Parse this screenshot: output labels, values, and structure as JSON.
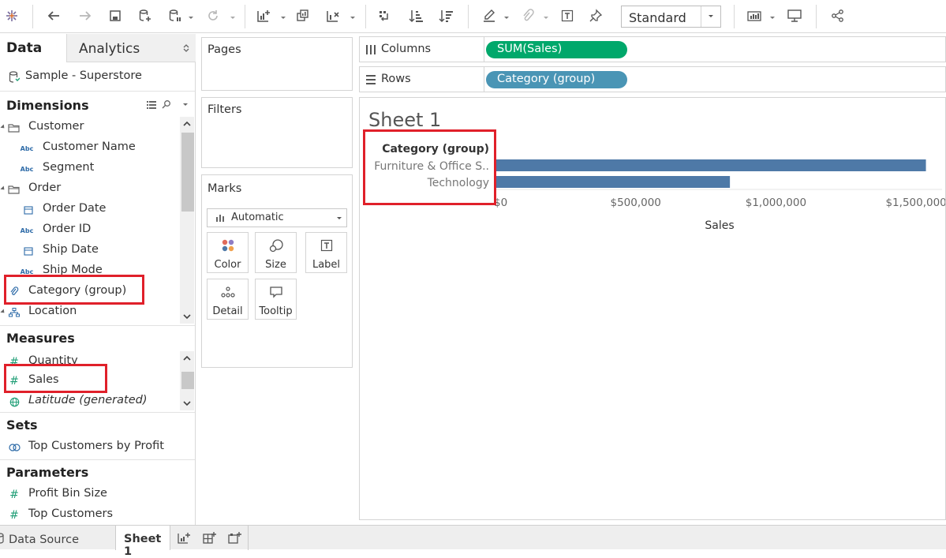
{
  "toolbar": {
    "mark_type_select": "Standard"
  },
  "data_pane": {
    "tabs": {
      "data": "Data",
      "analytics": "Analytics"
    },
    "datasource": "Sample - Superstore",
    "dimensions": {
      "header": "Dimensions",
      "items": [
        {
          "label": "Customer",
          "type": "folder"
        },
        {
          "label": "Customer Name",
          "type": "string"
        },
        {
          "label": "Segment",
          "type": "string"
        },
        {
          "label": "Order",
          "type": "folder"
        },
        {
          "label": "Order Date",
          "type": "date"
        },
        {
          "label": "Order ID",
          "type": "string"
        },
        {
          "label": "Ship Date",
          "type": "date"
        },
        {
          "label": "Ship Mode",
          "type": "string"
        },
        {
          "label": "Category (group)",
          "type": "group"
        },
        {
          "label": "Location",
          "type": "hierarchy"
        }
      ]
    },
    "measures": {
      "header": "Measures",
      "items": [
        {
          "label": "Quantity",
          "type": "number"
        },
        {
          "label": "Sales",
          "type": "number"
        },
        {
          "label": "Latitude (generated)",
          "type": "geo"
        }
      ]
    },
    "sets": {
      "header": "Sets",
      "items": [
        {
          "label": "Top Customers by Profit"
        }
      ]
    },
    "parameters": {
      "header": "Parameters",
      "items": [
        {
          "label": "Profit Bin Size"
        },
        {
          "label": "Top Customers"
        }
      ]
    },
    "abc_glyph": "Abc"
  },
  "cards": {
    "pages": "Pages",
    "filters": "Filters",
    "marks": {
      "title": "Marks",
      "type_select": "Automatic",
      "buttons": {
        "color": "Color",
        "size": "Size",
        "label": "Label",
        "detail": "Detail",
        "tooltip": "Tooltip"
      }
    }
  },
  "shelves": {
    "columns": {
      "label": "Columns",
      "pill": "SUM(Sales)",
      "pill_color": "#00a86b"
    },
    "rows": {
      "label": "Rows",
      "pill": "Category (group)",
      "pill_color": "#4a95b5"
    }
  },
  "sheet": {
    "title": "Sheet 1"
  },
  "chart_data": {
    "type": "bar",
    "orientation": "horizontal",
    "row_header": "Category (group)",
    "categories": [
      "Furniture & Office S..",
      "Technology"
    ],
    "values": [
      1535000,
      836000
    ],
    "xlabel": "Sales",
    "x_ticks": [
      "$0",
      "$500,000",
      "$1,000,000",
      "$1,500,000"
    ],
    "x_tick_values": [
      0,
      500000,
      1000000,
      1500000
    ],
    "xlim": [
      0,
      1570000
    ],
    "bar_color": "#4e79a7"
  },
  "bottom_tabs": {
    "data_source": "Data Source",
    "sheet1": "Sheet 1"
  },
  "colors": {
    "highlight": "#e0202a"
  }
}
